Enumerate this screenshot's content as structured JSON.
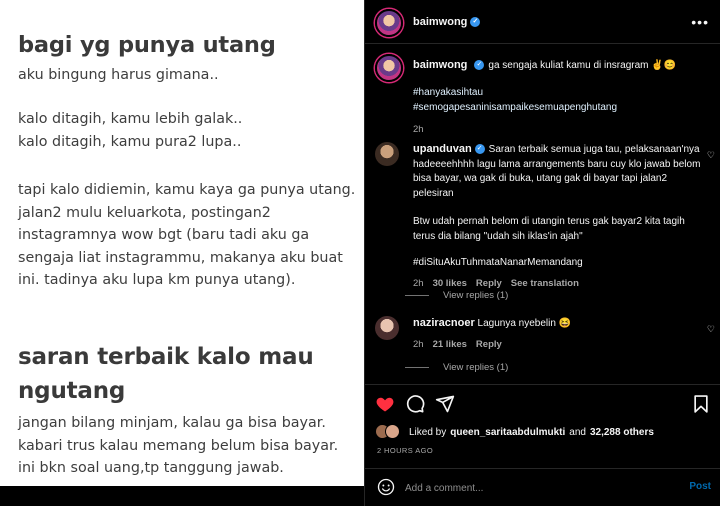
{
  "post_image": {
    "title1": "bagi yg punya utang",
    "block1": "aku bingung harus gimana..",
    "block2": "kalo ditagih, kamu lebih galak..\nkalo ditagih, kamu pura2 lupa..",
    "block3": "tapi kalo didiemin, kamu kaya ga punya utang. jalan2 mulu keluarkota, postingan2 instagramnya wow bgt (baru tadi aku ga sengaja liat instagrammu, makanya aku buat ini. tadinya aku lupa km punya utang).",
    "title2": "saran terbaik kalo mau ngutang",
    "block4": "jangan bilang minjam, kalau ga bisa bayar.\nkabari trus kalau memang belum bisa bayar.\nini bkn soal uang,tp tanggung jawab."
  },
  "header": {
    "username": "baimwong",
    "verified_icon": "verified-badge-icon",
    "more_icon": "more-options-icon"
  },
  "caption": {
    "username": "baimwong",
    "text": "ga sengaja kuliat kamu di insragram ✌️😊",
    "hashtags": "#hanyakasihtau\n#semogapesaninisampaikesemuapenghutang",
    "time": "2h"
  },
  "comments": [
    {
      "username": "upanduvan",
      "text": "Saran terbaik semua juga tau, pelaksanaan'nya hadeeeehhhh lagu lama arrangements baru cuy klo jawab belom bisa bayar, wa gak di buka, utang gak di bayar tapi jalan2 pelesiran",
      "text2": "Btw udah pernah belom di utangin terus gak bayar2 kita tagih terus dia bilang \"udah sih iklas'in ajah\"",
      "text3": "#diSituAkuTuhmataNanarMemandang",
      "time": "2h",
      "likes": "30 likes",
      "reply": "Reply",
      "see_translation": "See translation",
      "view_replies": "View replies (1)"
    },
    {
      "username": "naziracnoer",
      "text": "Lagunya nyebelin 😆",
      "time": "2h",
      "likes": "21 likes",
      "reply": "Reply",
      "view_replies": "View replies (1)"
    }
  ],
  "actions": {
    "like_icon": "heart-filled-icon",
    "comment_icon": "comment-icon",
    "share_icon": "share-icon",
    "save_icon": "bookmark-icon",
    "like_color": "#ff3040"
  },
  "likes": {
    "prefix": "Liked by",
    "user": "queen_saritaabdulmukti",
    "and": "and",
    "others": "32,288 others"
  },
  "post_time": "2 HOURS AGO",
  "add_comment": {
    "placeholder": "Add a comment...",
    "post_label": "Post",
    "emoji_icon": "emoji-icon"
  }
}
